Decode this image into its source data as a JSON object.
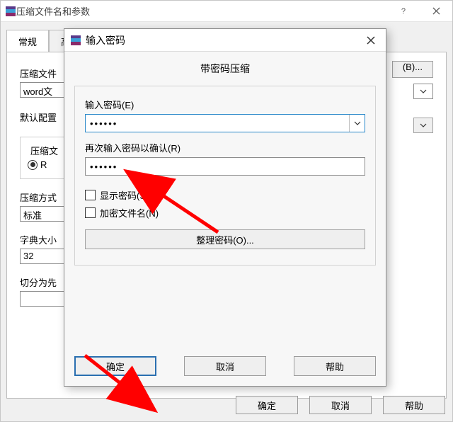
{
  "parent": {
    "title": "压缩文件名和参数",
    "tabs": {
      "general": "常规",
      "advanced_partial": "高"
    },
    "archive_name_label": "压缩文件",
    "archive_name_value": "word文",
    "browse_label": "(B)...",
    "profile_label": "默认配置",
    "format_group_label": "压缩文",
    "format_radio_partial": "R",
    "method_label": "压缩方式",
    "method_value": "标准",
    "dict_label": "字典大小",
    "dict_value": "32",
    "split_label": "切分为先",
    "buttons": {
      "ok": "确定",
      "cancel": "取消",
      "help": "帮助"
    }
  },
  "modal": {
    "title": "输入密码",
    "heading": "带密码压缩",
    "password_label": "输入密码(E)",
    "password_value": "••••••",
    "confirm_label": "再次输入密码以确认(R)",
    "confirm_value": "••••••",
    "show_password": "显示密码(S)",
    "encrypt_names": "加密文件名(N)",
    "manage_passwords": "整理密码(O)...",
    "buttons": {
      "ok": "确定",
      "cancel": "取消",
      "help": "帮助"
    }
  },
  "annotations": {
    "arrow_color": "#ff0000"
  }
}
